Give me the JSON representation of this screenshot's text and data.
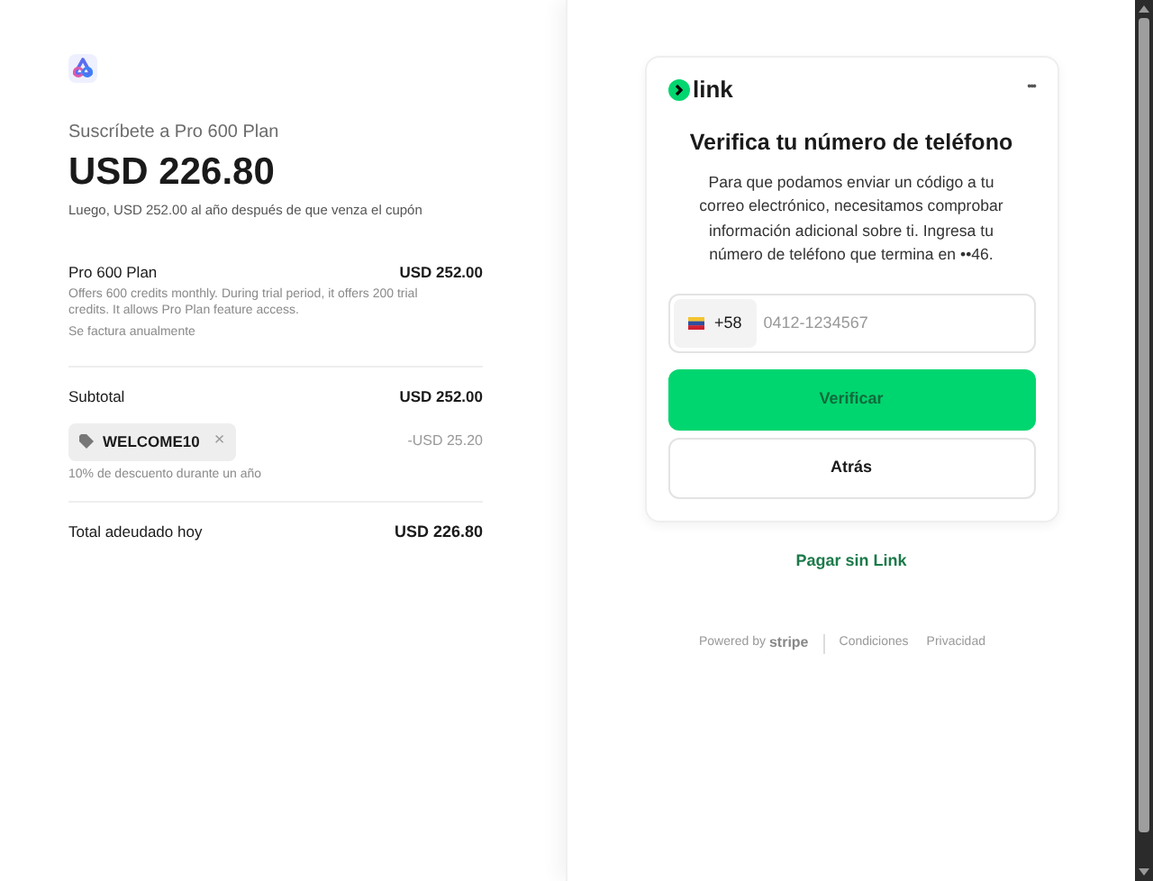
{
  "summary": {
    "subtitle": "Suscríbete a Pro 600 Plan",
    "total": "USD 226.80",
    "note": "Luego, USD 252.00 al año después de que venza el cupón",
    "item": {
      "name": "Pro 600 Plan",
      "price": "USD 252.00",
      "description": "Offers 600 credits monthly. During trial period, it offers 200 trial credits. It allows Pro Plan feature access.",
      "billing": "Se factura anualmente"
    },
    "subtotal": {
      "label": "Subtotal",
      "value": "USD 252.00"
    },
    "coupon": {
      "code": "WELCOME10",
      "remove": "×",
      "discount": "-USD 25.20",
      "detail": "10% de descuento durante un año"
    },
    "due": {
      "label": "Total adeudado hoy",
      "value": "USD 226.80"
    }
  },
  "link": {
    "brand": "link",
    "menu": "•••",
    "title": "Verifica tu número de teléfono",
    "message": "Para que podamos enviar un código a tu correo electrónico, necesitamos comprobar información adicional sobre ti. Ingresa tu número de teléfono que termina en ••46.",
    "phone": {
      "prefix": "+58",
      "placeholder": "0412-1234567"
    },
    "verify": {
      "label": "Verificar",
      "disabled": true
    },
    "back": "Atrás",
    "pay_without": "Pagar sin Link"
  },
  "footer": {
    "powered_by": "Powered by",
    "brand": "stripe",
    "links": [
      "Condiciones",
      "Privacidad"
    ]
  }
}
